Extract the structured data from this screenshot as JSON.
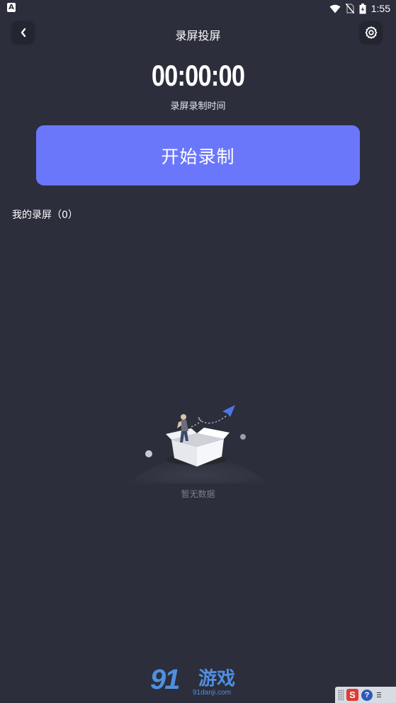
{
  "status_bar": {
    "left_icon": "A",
    "time": "1:55",
    "icons": [
      "wifi-icon",
      "no-sim-icon",
      "battery-icon"
    ]
  },
  "header": {
    "title": "录屏投屏",
    "back_icon": "chevron-left-icon",
    "settings_icon": "gear-icon"
  },
  "timer": {
    "value": "00:00:00",
    "label": "录屏录制时间"
  },
  "record_button": {
    "label": "开始录制"
  },
  "recordings": {
    "title": "我的录屏（0）"
  },
  "empty_state": {
    "text": "暂无数据",
    "illustration": "box-illustration"
  },
  "watermark": {
    "brand": "91",
    "name": "游戏",
    "url": "91danji.com"
  },
  "tray": {
    "s_label": "S",
    "help_label": "?"
  },
  "colors": {
    "background": "#2c2e3b",
    "accent": "#6b77fb",
    "muted_text": "#7c7f8f"
  }
}
